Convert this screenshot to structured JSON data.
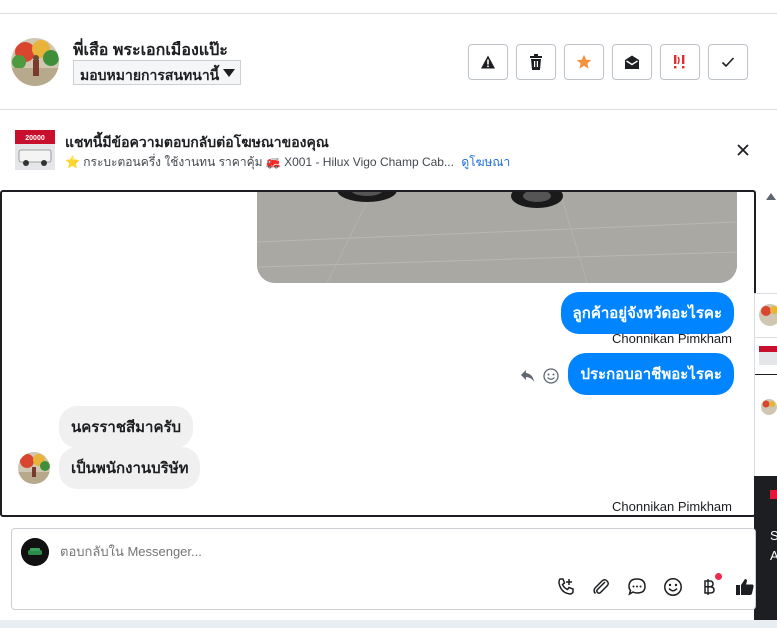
{
  "header": {
    "contact_name": "พี่เสือ พระเอกเมืองแป๊ะ",
    "assign_label": "มอบหมายการสนทนานี้",
    "actions": [
      {
        "icon": "warning-icon",
        "name": "spam-button"
      },
      {
        "icon": "trash-icon",
        "name": "delete-button"
      },
      {
        "icon": "star-icon",
        "name": "star-button",
        "color": "#f5923e"
      },
      {
        "icon": "envelope-open-icon",
        "name": "mark-unread-button"
      },
      {
        "icon": "follow-up-icon",
        "name": "follow-up-button",
        "color": "#e02d2d"
      },
      {
        "icon": "check-icon",
        "name": "done-button"
      }
    ]
  },
  "ad": {
    "thumb_badge": "20000",
    "title": "แชทนี้มีข้อความตอบกลับต่อโฆษณาของคุณ",
    "subtitle": "⭐ กระบะตอนครึ่ง ใช้งานทน ราคาคุ้ม 🚒 X001 - Hilux Vigo Champ Cab...",
    "link": "ดูโฆษณา"
  },
  "messages": {
    "out_1": "ลูกค้าอยู่จังหวัดอะไรคะ",
    "sender_1": "Chonnikan Pimkham",
    "out_2": "ประกอบอาชีพอะไรคะ",
    "in_1": "นครราชสีมาครับ",
    "in_2": "เป็นพนักงานบริษัท",
    "sender_2": "Chonnikan Pimkham"
  },
  "side": {
    "line1": "S",
    "line2": "A"
  },
  "composer": {
    "placeholder": "ตอบกลับใน Messenger..."
  },
  "colors": {
    "accent": "#0084ff",
    "link": "#216fdb"
  }
}
